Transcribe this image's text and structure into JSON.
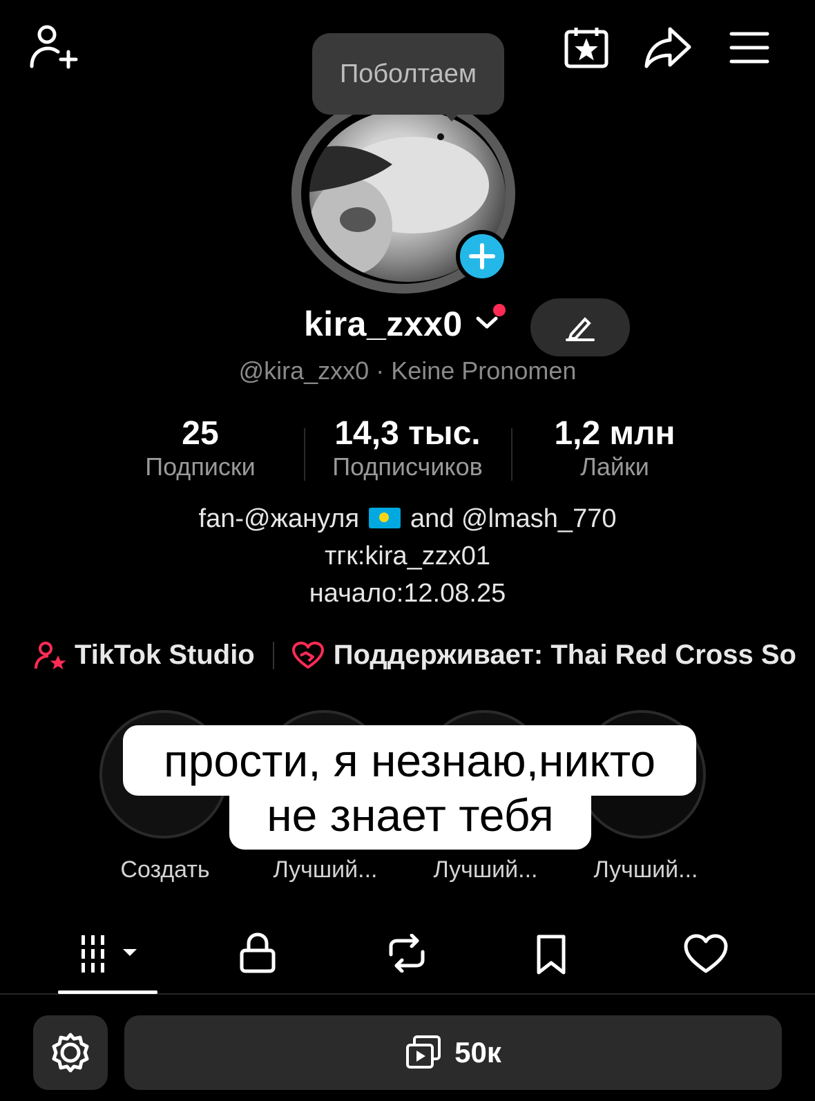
{
  "header": {
    "icons": [
      "add-friend-icon",
      "calendar-star-icon",
      "share-icon",
      "menu-icon"
    ]
  },
  "chat_bubble": {
    "label": "Поболтаем"
  },
  "profile": {
    "display_name": "kira_zxx0",
    "handle_line": "@kira_zxx0 · Keine Pronomen",
    "accent": "#24b8e8",
    "notify_color": "#fe2c55"
  },
  "stats": [
    {
      "value": "25",
      "label": "Подписки"
    },
    {
      "value": "14,3 тыс.",
      "label": "Подписчиков"
    },
    {
      "value": "1,2 млн",
      "label": "Лайки"
    }
  ],
  "bio": {
    "line1_prefix": "fan-@жануля",
    "line1_suffix": "and @lmash_770",
    "line2": "тгк:kira_zzx01",
    "line3": "начало:12.08.25"
  },
  "links": {
    "studio": "TikTok Studio",
    "supports": "Поддерживает: Thai Red Cross So"
  },
  "highlights": [
    {
      "label": "Создать"
    },
    {
      "label": "Лучший..."
    },
    {
      "label": "Лучший..."
    },
    {
      "label": "Лучший..."
    }
  ],
  "caption": {
    "line1": "прости, я незнаю,никто",
    "line2": "не знает тебя"
  },
  "tabs": [
    "videos-grid-icon",
    "lock-icon",
    "repost-icon",
    "bookmark-icon",
    "heart-icon"
  ],
  "footer": {
    "views": "50к"
  }
}
